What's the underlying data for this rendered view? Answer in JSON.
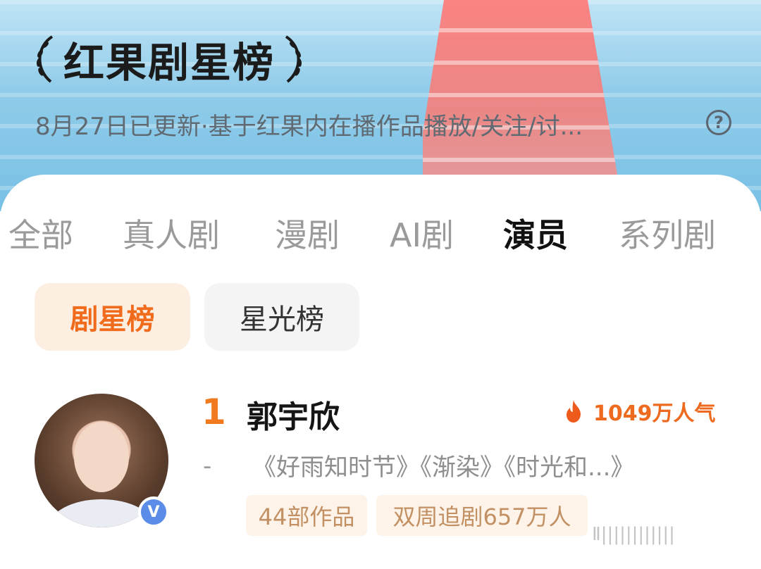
{
  "header": {
    "title": "红果剧星榜",
    "subtitle": "8月27日已更新·基于红果内在播作品播放/关注/讨...",
    "help_icon": "?"
  },
  "tabs": [
    {
      "label": "全部",
      "active": false
    },
    {
      "label": "真人剧",
      "active": false
    },
    {
      "label": "漫剧",
      "active": false
    },
    {
      "label": "AI剧",
      "active": false
    },
    {
      "label": "演员",
      "active": true
    },
    {
      "label": "系列剧",
      "active": false
    }
  ],
  "segments": [
    {
      "label": "剧星榜",
      "active": true
    },
    {
      "label": "星光榜",
      "active": false
    }
  ],
  "ranking": [
    {
      "rank": "1",
      "name": "郭宇欣",
      "popularity": "1049万人气",
      "trend": "-",
      "works": "《好雨知时节》《渐染》《时光和...》",
      "chips": [
        "44部作品",
        "双周追剧657万人"
      ],
      "verified_badge": "V"
    }
  ],
  "watermark": "Ⅱ||||||||||||",
  "colors": {
    "accent": "#f06b1c",
    "rank": "#f07a1d",
    "chip_bg": "#fdf3e8",
    "chip_text": "#c29063"
  }
}
